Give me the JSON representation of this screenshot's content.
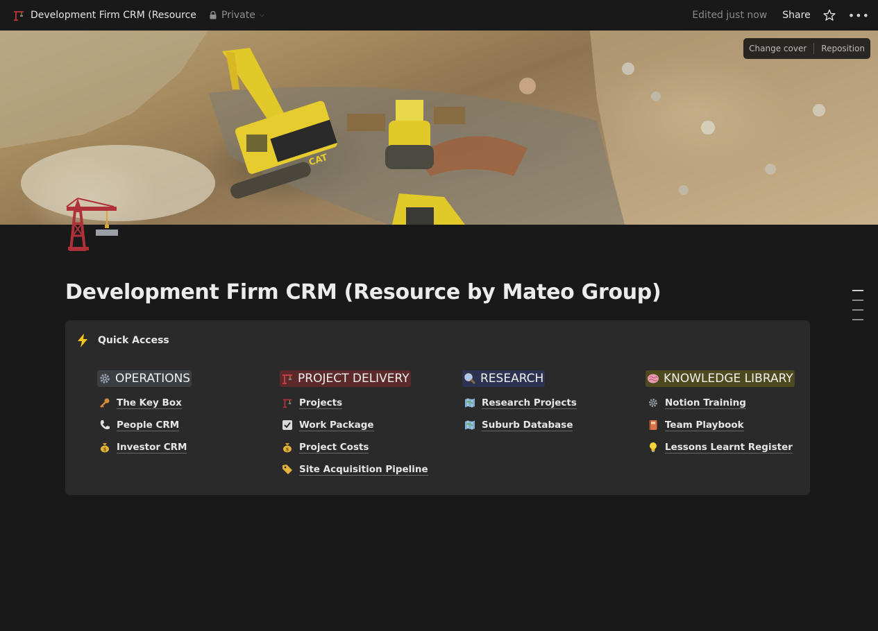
{
  "topbar": {
    "title": "Development Firm CRM (Resource b...",
    "privacy": "Private",
    "edited": "Edited just now",
    "share": "Share",
    "icons": {
      "page": "crane-icon",
      "lock": "lock-icon",
      "star": "star-icon",
      "more": "more-icon"
    }
  },
  "cover": {
    "change_cover": "Change cover",
    "reposition": "Reposition",
    "cat_logo": "CAT"
  },
  "page": {
    "title": "Development Firm CRM (Resource by Mateo Group)"
  },
  "callout": {
    "label": "Quick Access",
    "icon": "lightning-icon",
    "columns": [
      {
        "heading": "OPERATIONS",
        "heading_icon": "gear-icon",
        "highlight": "#3b3e42",
        "items": [
          {
            "label": "The Key Box",
            "icon": "key-icon"
          },
          {
            "label": "People CRM",
            "icon": "phone-icon"
          },
          {
            "label": "Investor CRM",
            "icon": "money-bag-icon"
          }
        ]
      },
      {
        "heading": "PROJECT DELIVERY",
        "heading_icon": "crane-icon",
        "highlight": "#5c2a2a",
        "items": [
          {
            "label": "Projects",
            "icon": "crane-icon"
          },
          {
            "label": "Work Package",
            "icon": "checkbox-icon"
          },
          {
            "label": "Project Costs",
            "icon": "money-bag-icon"
          },
          {
            "label": "Site Acquisition Pipeline",
            "icon": "tag-icon"
          }
        ]
      },
      {
        "heading": "RESEARCH",
        "heading_icon": "magnifier-icon",
        "highlight": "#2c3350",
        "items": [
          {
            "label": "Research Projects",
            "icon": "map-icon"
          },
          {
            "label": "Suburb Database",
            "icon": "map-icon"
          }
        ]
      },
      {
        "heading": "KNOWLEDGE LIBRARY",
        "heading_icon": "brain-icon",
        "highlight": "#4c4a1e",
        "items": [
          {
            "label": "Notion Training",
            "icon": "gear-icon"
          },
          {
            "label": "Team Playbook",
            "icon": "notebook-icon"
          },
          {
            "label": "Lessons Learnt Register",
            "icon": "lightbulb-icon"
          }
        ]
      }
    ]
  }
}
